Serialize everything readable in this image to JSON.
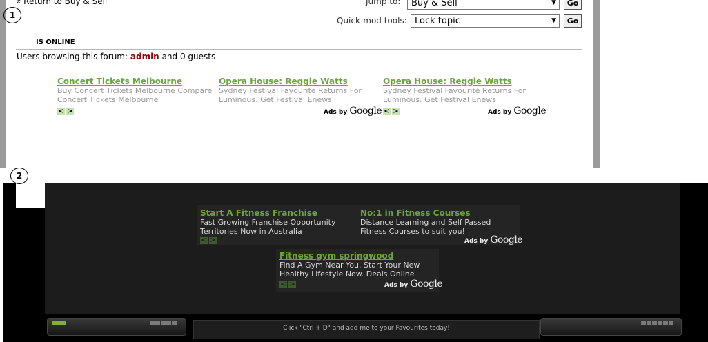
{
  "colors": {
    "ad_title": "#6aa63b",
    "ad_text_light": "#9a9a9a",
    "ad_text_dark": "#d8d8d8",
    "admin": "#990000",
    "panel2_bg": "#1c1c1c"
  },
  "labels": {
    "one": "1",
    "two": "2"
  },
  "forum": {
    "return_link": "« Return to Buy & Sell",
    "jump_label": "Jump to:",
    "jump_value": "Buy & Sell",
    "quickmod_label": "Quick-mod tools:",
    "quickmod_value": "Lock topic",
    "go": "Go",
    "online_title": "IS ONLINE",
    "browsing_prefix": "Users browsing this forum:",
    "browsing_user": "admin",
    "browsing_suffix": "and 0 guests"
  },
  "ads_panel1": [
    {
      "title": "Concert Tickets Melbourne",
      "lines": [
        "Buy Concert Tickets Melbourne Compare",
        "Concert Tickets Melbourne"
      ]
    },
    {
      "title": "Opera House: Reggie Watts",
      "lines": [
        "Sydney Festival Favourite Returns For",
        "Luminous. Get Festival Enews"
      ]
    },
    {
      "title": "Opera House: Reggie Watts",
      "lines": [
        "Sydney Festival Favourite Returns For",
        "Luminous. Get Festival Enews"
      ]
    }
  ],
  "ads_panel2": [
    {
      "title": "Start A Fitness Franchise",
      "lines": [
        "Fast Growing Franchise Opportunity",
        "Territories Now in Australia"
      ]
    },
    {
      "title": "No:1 in Fitness Courses",
      "lines": [
        "Distance Learning and Self Passed",
        "Fitness Courses to suit you!"
      ]
    },
    {
      "title": "Fitness gym springwood",
      "lines": [
        "Find A Gym Near You. Start Your New",
        "Healthy Lifestyle Now. Deals Online"
      ]
    }
  ],
  "ads_by": {
    "prefix": "Ads by",
    "brand": "Google"
  },
  "nav": {
    "prev": "<",
    "next": ">"
  },
  "footer": {
    "text": "Click \"Ctrl + D\" and add me to your Favourites today!"
  }
}
